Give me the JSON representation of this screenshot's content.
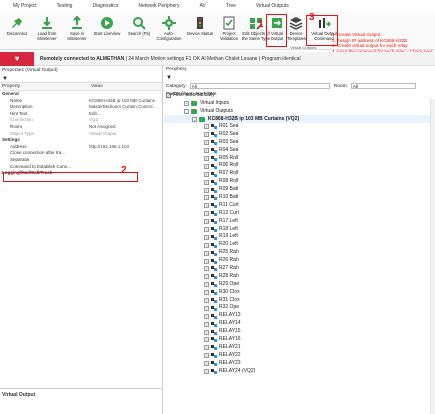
{
  "ribbon": {
    "tabs": [
      "My Project",
      "Testing",
      "Diagnostics",
      "Network Periphery",
      "AV",
      "Tree",
      "Virtual Outputs"
    ],
    "buttons": [
      {
        "label": "Disconnect",
        "icon": "disconnect-icon",
        "color": "#3aa34b"
      },
      {
        "label": "Load from Miniserver",
        "icon": "download-icon",
        "color": "#3aa34b"
      },
      {
        "label": "Save in Miniserver",
        "icon": "upload-icon",
        "color": "#3aa34b"
      },
      {
        "label": "Start LiveView",
        "icon": "play-icon",
        "color": "#3aa34b"
      },
      {
        "label": "Search (F5)",
        "icon": "search-icon",
        "color": "#3aa34b"
      },
      {
        "label": "Auto-Configuration",
        "icon": "gear-icon",
        "color": "#3aa34b"
      },
      {
        "label": "Device Status",
        "icon": "device-status-icon",
        "color": "#444444"
      },
      {
        "label": "Project Validation",
        "icon": "validation-icon",
        "color": "#3aa34b"
      },
      {
        "label": "Edit Objects of the Same Type",
        "icon": "edit-objects-icon",
        "color": "#3aa34b"
      },
      {
        "label": "Virtual Output",
        "icon": "virtual-output-icon",
        "color": "#3aa34b"
      },
      {
        "label": "Device Templates",
        "icon": "templates-icon",
        "color": "#444444"
      },
      {
        "label": "Virtual Output Command",
        "icon": "virtual-output-command-icon",
        "color": "#3aa34b"
      }
    ],
    "group_label": "Virtual Outputs"
  },
  "annotations": {
    "num1": "1",
    "num2": "2",
    "num3": "3",
    "instructions": [
      "1. Create Virtual Output",
      "2. Assign IP address of KC868-H32B",
      "3. Create virtual output for each relay",
      "4. Input the command for each relay - Check next slide."
    ],
    "color": "#e11111"
  },
  "connection": {
    "status_bold": "Remotely connected to ALMETHAN",
    "details": "| 24 March Motion settings F1 OK Al Methan Chalet Louane  |  Program identical"
  },
  "properties": {
    "title": "Properties (Virtual Output)",
    "col_property": "Property",
    "col_value": "Value",
    "rows": [
      {
        "k": "General",
        "v": "",
        "cat": true
      },
      {
        "k": "Name",
        "v": "KC868-H32B ip 103 MB Curtains"
      },
      {
        "k": "Description",
        "v": "MasterBedroom Curtain Control..."
      },
      {
        "k": "Hint Text",
        "v": "Edit..."
      },
      {
        "k": "Connection",
        "v": "VQ2",
        "gray": true
      },
      {
        "k": "Room",
        "v": "Not Assigned"
      },
      {
        "k": "Object Type",
        "v": "Virtual Output",
        "gray": true
      },
      {
        "k": "Settings",
        "v": "",
        "cat": true
      },
      {
        "k": "Address",
        "v": "http://192.168.1.103"
      },
      {
        "k": "Close connection after tra...",
        "v": ""
      },
      {
        "k": "Separator",
        "v": ""
      },
      {
        "k": "Command to Establish Conn...",
        "v": ""
      },
      {
        "k": "Logging/Mail/Call/Track",
        "v": "",
        "cat": true
      }
    ],
    "bottom_title": "Virtual Output"
  },
  "periphery": {
    "title": "Periphery",
    "category_label": "Category:",
    "category_value": "All",
    "room_label": "Room:",
    "room_value": "All",
    "preset_label": "Preset filters:",
    "preset_value": "No Filters",
    "filter_auto": "Filter automatically",
    "tree_inputs": "Virtual Inputs",
    "tree_outputs": "Virtual Outputs",
    "tree_device": "KC868-H32B ip 103 MB Curtains (VQ2)",
    "relays": [
      "R01 Sea",
      "R02 Sea",
      "R03 Sea",
      "R04 Sea",
      "R05 Roll",
      "R06 Roll",
      "R07 Roll",
      "R08 Roll",
      "R09 Batl",
      "R10 Batl",
      "R11 Curt",
      "R12 Curt",
      "R17 Left",
      "R18 Left",
      "R19 Left",
      "R20 Left",
      "R25 Rah",
      "R26 Rah",
      "R27 Rah",
      "R28 Rah",
      "R29 Ope",
      "R30 Clos",
      "R31 Clos",
      "R32 Ope",
      "RELAY13",
      "RELAY14",
      "RELAY15",
      "RELAY16",
      "RELAY21",
      "RELAY22",
      "RELAY23",
      "RELAY24 (VQ2)"
    ]
  }
}
